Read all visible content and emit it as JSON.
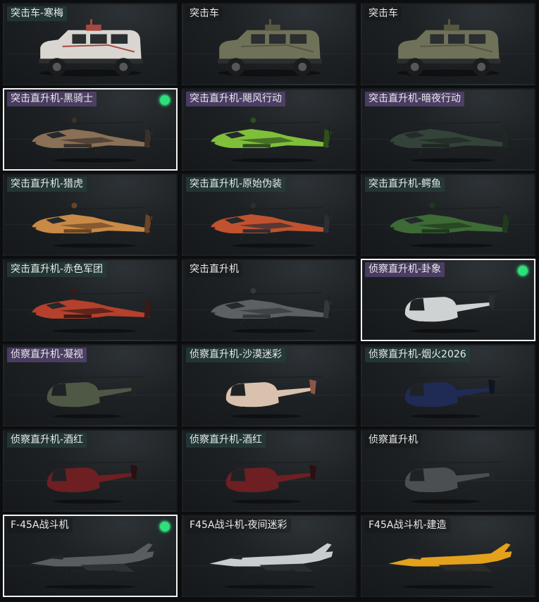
{
  "items": [
    {
      "label": "突击车-寒梅",
      "kind": "truck",
      "tag": "teal",
      "selected": false,
      "equipped": false,
      "colors": [
        "#d9d6d2",
        "#a5483f"
      ]
    },
    {
      "label": "突击车",
      "kind": "truck",
      "tag": "plain",
      "selected": false,
      "equipped": false,
      "colors": [
        "#6f7158",
        "#55573f"
      ]
    },
    {
      "label": "突击车",
      "kind": "truck",
      "tag": "plain",
      "selected": false,
      "equipped": false,
      "colors": [
        "#6f7158",
        "#55573f"
      ]
    },
    {
      "label": "突击直升机-黑骑士",
      "kind": "attack",
      "tag": "purple",
      "selected": true,
      "equipped": true,
      "colors": [
        "#8a7056",
        "#3a3129"
      ]
    },
    {
      "label": "突击直升机-飓风行动",
      "kind": "attack",
      "tag": "purple",
      "selected": false,
      "equipped": false,
      "colors": [
        "#7fbf3a",
        "#2e4f1c"
      ]
    },
    {
      "label": "突击直升机-暗夜行动",
      "kind": "attack",
      "tag": "purple",
      "selected": false,
      "equipped": false,
      "colors": [
        "#34433a",
        "#1e2722"
      ]
    },
    {
      "label": "突击直升机-猎虎",
      "kind": "attack",
      "tag": "teal",
      "selected": false,
      "equipped": false,
      "colors": [
        "#c88a46",
        "#6a4426"
      ]
    },
    {
      "label": "突击直升机-原始伪装",
      "kind": "attack",
      "tag": "teal",
      "selected": false,
      "equipped": false,
      "colors": [
        "#c0522f",
        "#2c2e34"
      ]
    },
    {
      "label": "突击直升机-鳄鱼",
      "kind": "attack",
      "tag": "teal",
      "selected": false,
      "equipped": false,
      "colors": [
        "#3d6a35",
        "#1f3a1d"
      ]
    },
    {
      "label": "突击直升机-赤色军团",
      "kind": "attack",
      "tag": "teal",
      "selected": false,
      "equipped": false,
      "colors": [
        "#b5402b",
        "#3a1a16"
      ]
    },
    {
      "label": "突击直升机",
      "kind": "attack",
      "tag": "plain",
      "selected": false,
      "equipped": false,
      "colors": [
        "#5b6062",
        "#34383b"
      ]
    },
    {
      "label": "侦察直升机-卦象",
      "kind": "scout",
      "tag": "purple",
      "selected": true,
      "equipped": true,
      "colors": [
        "#cfd2d2",
        "#2a2c2e"
      ]
    },
    {
      "label": "侦察直升机-凝视",
      "kind": "scout",
      "tag": "purple",
      "selected": false,
      "equipped": false,
      "colors": [
        "#4f5845",
        "#23271f"
      ]
    },
    {
      "label": "侦察直升机-沙漠迷彩",
      "kind": "scout",
      "tag": "teal",
      "selected": false,
      "equipped": false,
      "colors": [
        "#d9c2ad",
        "#8a5744"
      ]
    },
    {
      "label": "侦察直升机-烟火2026",
      "kind": "scout",
      "tag": "teal",
      "selected": false,
      "equipped": false,
      "colors": [
        "#1f2b55",
        "#101522"
      ]
    },
    {
      "label": "侦察直升机-酒红",
      "kind": "scout",
      "tag": "teal",
      "selected": false,
      "equipped": false,
      "colors": [
        "#6e1f22",
        "#2a1012"
      ]
    },
    {
      "label": "侦察直升机-酒红",
      "kind": "scout",
      "tag": "teal",
      "selected": false,
      "equipped": false,
      "colors": [
        "#6e1f22",
        "#2a1012"
      ]
    },
    {
      "label": "侦察直升机",
      "kind": "scout",
      "tag": "plain",
      "selected": false,
      "equipped": false,
      "colors": [
        "#4c4f52",
        "#232527"
      ]
    },
    {
      "label": "F-45A战斗机",
      "kind": "jet",
      "tag": "plain",
      "selected": true,
      "equipped": true,
      "colors": [
        "#595d60",
        "#2e3133"
      ]
    },
    {
      "label": "F45A战斗机-夜间迷彩",
      "kind": "jet",
      "tag": "plain",
      "selected": false,
      "equipped": false,
      "colors": [
        "#c9ccd0",
        "#2a2d31"
      ]
    },
    {
      "label": "F45A战斗机-建造",
      "kind": "jet",
      "tag": "plain",
      "selected": false,
      "equipped": false,
      "colors": [
        "#e3a11c",
        "#2b2b2b"
      ]
    }
  ]
}
